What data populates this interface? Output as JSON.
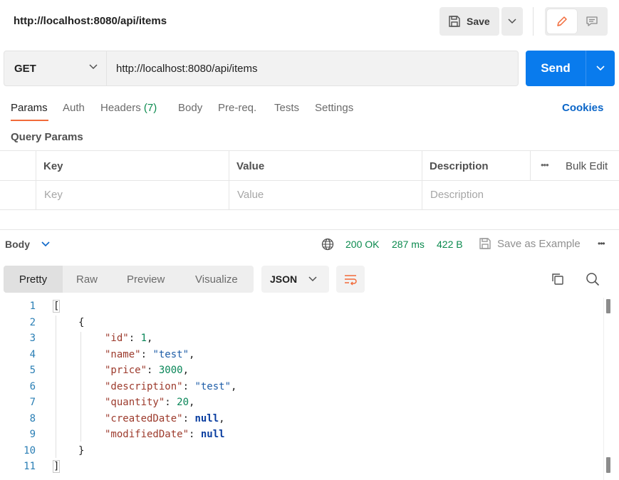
{
  "header": {
    "title": "http://localhost:8080/api/items",
    "save_label": "Save"
  },
  "request": {
    "method": "GET",
    "url": "http://localhost:8080/api/items",
    "send_label": "Send"
  },
  "tabs": {
    "params": "Params",
    "auth": "Auth",
    "headers": "Headers",
    "headers_count": "(7)",
    "body": "Body",
    "prereq": "Pre-req.",
    "tests": "Tests",
    "settings": "Settings",
    "cookies": "Cookies"
  },
  "query_params": {
    "title": "Query Params",
    "columns": {
      "key": "Key",
      "value": "Value",
      "description": "Description"
    },
    "more": "•••",
    "bulk_edit": "Bulk Edit",
    "placeholders": {
      "key": "Key",
      "value": "Value",
      "description": "Description"
    }
  },
  "response": {
    "body_label": "Body",
    "status": "200 OK",
    "time": "287 ms",
    "size": "422 B",
    "save_example": "Save as Example",
    "more": "•••",
    "view_tabs": [
      "Pretty",
      "Raw",
      "Preview",
      "Visualize"
    ],
    "format": "JSON"
  },
  "code": {
    "line_numbers": [
      "1",
      "2",
      "3",
      "4",
      "5",
      "6",
      "7",
      "8",
      "9",
      "10",
      "11"
    ],
    "open_bracket": "[",
    "open_brace": "{",
    "close_brace": "}",
    "close_bracket": "]",
    "fields": [
      {
        "key": "\"id\"",
        "value": "1",
        "type": "number"
      },
      {
        "key": "\"name\"",
        "value": "\"test\"",
        "type": "string"
      },
      {
        "key": "\"price\"",
        "value": "3000",
        "type": "number"
      },
      {
        "key": "\"description\"",
        "value": "\"test\"",
        "type": "string"
      },
      {
        "key": "\"quantity\"",
        "value": "20",
        "type": "number"
      },
      {
        "key": "\"createdDate\"",
        "value": "null",
        "type": "null"
      },
      {
        "key": "\"modifiedDate\"",
        "value": "null",
        "type": "null"
      }
    ]
  },
  "colors": {
    "accent": "#097bed",
    "tab_underline": "#f26b3a",
    "status_green": "#0b8a4e",
    "link": "#0b66c8"
  },
  "icons": {
    "save": "floppy-disk-icon",
    "edit": "pencil-icon",
    "docs": "comment-icon",
    "globe": "globe-icon",
    "wrap": "wrap-lines-icon",
    "copy": "copy-icon",
    "search": "search-icon"
  }
}
